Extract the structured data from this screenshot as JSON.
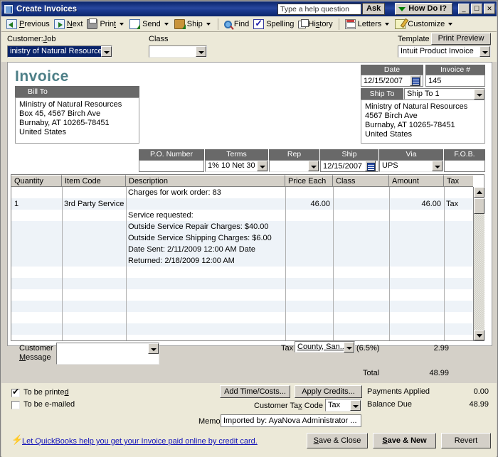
{
  "window": {
    "title": "Create Invoices",
    "help_placeholder": "Type a help question",
    "ask_label": "Ask",
    "how_do_i_label": "How Do I?",
    "minimize": "_",
    "maximize": "☐",
    "close": "✕"
  },
  "toolbar": {
    "items": [
      {
        "label": "Previous",
        "icon": "previous-icon",
        "caret": false
      },
      {
        "label": "Next",
        "icon": "next-icon",
        "caret": false
      },
      {
        "label": "Print",
        "icon": "print-icon",
        "caret": true
      },
      {
        "label": "Send",
        "icon": "send-icon",
        "caret": true
      },
      {
        "label": "Ship",
        "icon": "ship-icon",
        "caret": true
      },
      {
        "label": "Find",
        "icon": "find-icon",
        "caret": false
      },
      {
        "label": "Spelling",
        "icon": "spelling-icon",
        "caret": false
      },
      {
        "label": "History",
        "icon": "history-icon",
        "caret": false
      },
      {
        "label": "Letters",
        "icon": "letters-icon",
        "caret": true
      },
      {
        "label": "Customize",
        "icon": "customize-icon",
        "caret": true
      }
    ]
  },
  "fields": {
    "customer_job_label": "Customer:Job",
    "customer_job_value": "inistry of Natural Resources",
    "class_label": "Class",
    "class_value": "",
    "template_label": "Template",
    "template_value": "Intuit Product Invoice",
    "print_preview_label": "Print Preview"
  },
  "invoice": {
    "heading": "Invoice",
    "bill_to_label": "Bill To",
    "bill_to_lines": [
      "Ministry of Natural Resources",
      "Box 45, 4567 Birch Ave",
      "Burnaby, AT 10265-78451",
      "United States"
    ],
    "date_label": "Date",
    "date_value": "12/15/2007",
    "invoice_no_label": "Invoice #",
    "invoice_no_value": "145",
    "ship_to_label": "Ship To",
    "ship_to_value": "Ship To 1",
    "ship_to_lines": [
      "Ministry of Natural Resources",
      "4567 Birch Ave",
      "Burnaby, AT 10265-78451",
      "United States"
    ]
  },
  "terms_band": {
    "po_number_label": "P.O. Number",
    "po_number_value": "",
    "terms_label": "Terms",
    "terms_value": "1% 10 Net 30",
    "rep_label": "Rep",
    "rep_value": "",
    "ship_label": "Ship",
    "ship_value": "12/15/2007",
    "via_label": "Via",
    "via_value": "UPS",
    "fob_label": "F.O.B.",
    "fob_value": ""
  },
  "grid": {
    "columns": [
      "Quantity",
      "Item Code",
      "Description",
      "Price Each",
      "Class",
      "Amount",
      "Tax"
    ],
    "rows": [
      {
        "quantity": "",
        "item_code": "",
        "description": "Charges for work order: 83",
        "price_each": "",
        "class": "",
        "amount": "",
        "tax": ""
      },
      {
        "quantity": "1",
        "item_code": "3rd Party Service",
        "description": "",
        "price_each": "46.00",
        "class": "",
        "amount": "46.00",
        "tax": "Tax"
      },
      {
        "quantity": "",
        "item_code": "",
        "description": "Service requested:",
        "price_each": "",
        "class": "",
        "amount": "",
        "tax": ""
      },
      {
        "quantity": "",
        "item_code": "",
        "description": "Outside Service Repair Charges: $40.00",
        "price_each": "",
        "class": "",
        "amount": "",
        "tax": ""
      },
      {
        "quantity": "",
        "item_code": "",
        "description": "Outside Service Shipping Charges: $6.00",
        "price_each": "",
        "class": "",
        "amount": "",
        "tax": ""
      },
      {
        "quantity": "",
        "item_code": "",
        "description": "Date Sent: 2/11/2009 12:00 AM  Date",
        "price_each": "",
        "class": "",
        "amount": "",
        "tax": ""
      },
      {
        "quantity": "",
        "item_code": "",
        "description": "Returned: 2/18/2009 12:00 AM",
        "price_each": "",
        "class": "",
        "amount": "",
        "tax": ""
      }
    ]
  },
  "footer": {
    "customer_message_label_1": "Customer",
    "customer_message_label_2": "Message",
    "customer_message_value": "",
    "tax_label": "Tax",
    "tax_value": "County, San...",
    "tax_rate": "(6.5%)",
    "tax_amount": "2.99",
    "total_label": "Total",
    "total_amount": "48.99"
  },
  "actions": {
    "to_be_printed_label": "To be printed",
    "to_be_printed_checked": true,
    "to_be_emailed_label": "To be e-mailed",
    "to_be_emailed_checked": false,
    "add_time_costs_label": "Add Time/Costs...",
    "apply_credits_label": "Apply Credits...",
    "payments_applied_label": "Payments Applied",
    "payments_applied_amount": "0.00",
    "balance_due_label": "Balance Due",
    "balance_due_amount": "48.99",
    "customer_tax_code_label": "Customer Tax Code",
    "customer_tax_code_value": "Tax",
    "memo_label": "Memo",
    "memo_value": "Imported by: AyaNova Administrator ...",
    "promo_link": "Let QuickBooks help you get your Invoice paid online by credit card.",
    "save_close_label": "Save & Close",
    "save_new_label": "Save & New",
    "revert_label": "Revert"
  }
}
